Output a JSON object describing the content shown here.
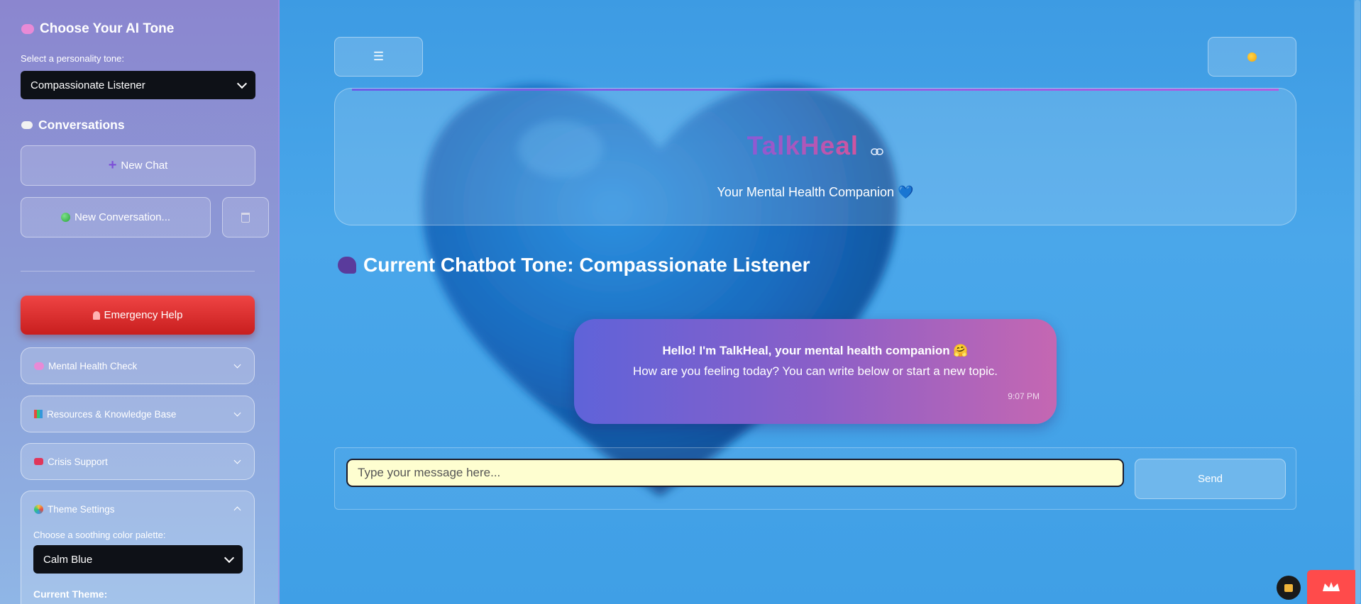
{
  "sidebar": {
    "tone_title": "Choose Your AI Tone",
    "tone_label": "Select a personality tone:",
    "tone_selected": "Compassionate Listener",
    "conversations_title": "Conversations",
    "new_chat_label": "New Chat",
    "new_conversation_label": "New Conversation...",
    "emergency_label": "Emergency Help",
    "expanders": [
      {
        "label": "Mental Health Check",
        "icon": "brain-icon",
        "expanded": false
      },
      {
        "label": "Resources & Knowledge Base",
        "icon": "books-icon",
        "expanded": false
      },
      {
        "label": "Crisis Support",
        "icon": "phone-icon",
        "expanded": false
      },
      {
        "label": "Theme Settings",
        "icon": "palette-icon",
        "expanded": true
      }
    ],
    "theme_palette_label": "Choose a soothing color palette:",
    "theme_selected": "Calm Blue",
    "current_theme_label": "Current Theme:"
  },
  "header": {
    "app_title": "TalkHeal",
    "subtitle": "Your Mental Health Companion 💙"
  },
  "main": {
    "tone_heading": "Current Chatbot Tone: Compassionate Listener",
    "bubble": {
      "line1": "Hello! I'm TalkHeal, your mental health companion 🤗",
      "line2": "How are you feeling today? You can write below or start a new topic.",
      "time": "9:07 PM"
    },
    "input_placeholder": "Type your message here...",
    "send_label": "Send",
    "menu_icon": "☰"
  },
  "colors": {
    "background": "#45a3e8",
    "emergency": "#dc2626",
    "input_bg": "#fefed0",
    "select_bg": "#0e1117",
    "brand_gradient": [
      "#8a5ad6",
      "#d0559f"
    ]
  }
}
